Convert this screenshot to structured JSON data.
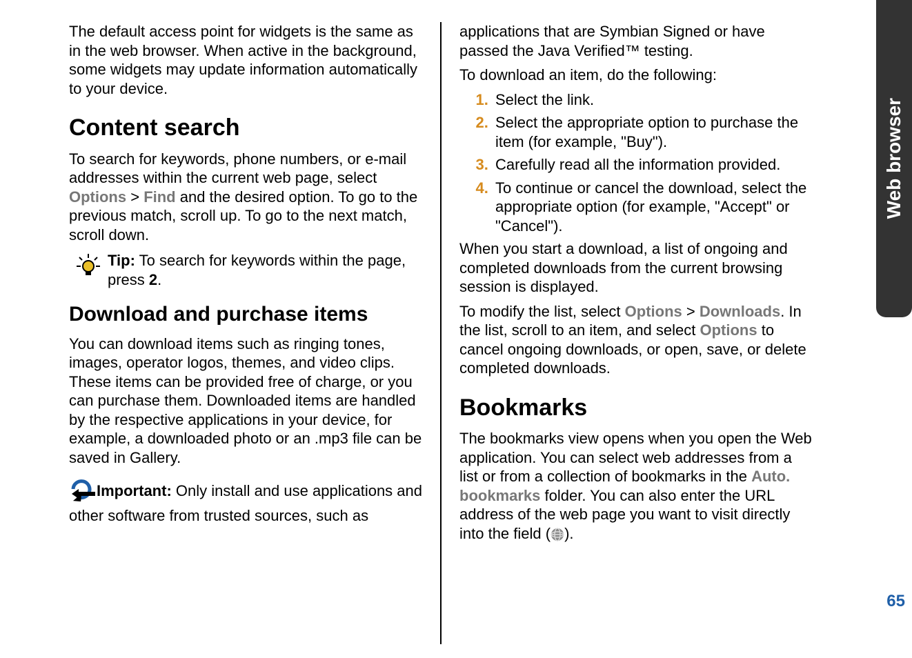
{
  "sidebar": {
    "label": "Web browser"
  },
  "page_number": "65",
  "left": {
    "para1": "The default access point for widgets is the same as in the web browser. When active in the background, some widgets may update information automatically to your device.",
    "h_search": "Content search",
    "search_pre": "To search for keywords, phone numbers, or e-mail addresses within the current web page, select ",
    "options": "Options",
    "gt": " > ",
    "find": "Find",
    "search_post": " and the desired option. To go to the previous match, scroll up. To go to the next match, scroll down.",
    "tip_label": "Tip:",
    "tip_text": " To search for keywords within the page, press ",
    "tip_key": "2",
    "tip_end": ".",
    "h_download": "Download and purchase items",
    "download_para": "You can download items such as ringing tones, images, operator logos, themes, and video clips. These items can be provided free of charge, or you can purchase them. Downloaded items are handled by the respective applications in your device, for example, a downloaded photo or an .mp3 file can be saved in Gallery.",
    "important_label": "Important:",
    "important_text": "  Only install and use applications and other software from trusted sources, such as "
  },
  "right": {
    "cont": "applications that are Symbian Signed or have passed the Java Verified™ testing.",
    "dl_intro": "To download an item, do the following:",
    "steps": [
      "Select the link.",
      "Select the appropriate option to purchase the item (for example, \"Buy\").",
      "Carefully read all the information provided.",
      "To continue or cancel the download, select the appropriate option (for example, \"Accept\" or \"Cancel\")."
    ],
    "dl_note": "When you start a download, a list of ongoing and completed downloads from the current browsing session is displayed.",
    "modify_pre": "To modify the list, select ",
    "options": "Options",
    "gt": " > ",
    "downloads": "Downloads",
    "modify_mid": ". In the list, scroll to an item, and select ",
    "options2": "Options",
    "modify_post": " to cancel ongoing downloads, or open, save, or delete completed downloads.",
    "h_bookmarks": "Bookmarks",
    "bm_pre": "The bookmarks view opens when you open the Web application. You can select web addresses from a list or from a collection of bookmarks in the ",
    "auto_bookmarks": "Auto. bookmarks",
    "bm_mid": " folder. You can also enter the URL address of the web page you want to visit directly into the field (",
    "bm_post": ")."
  }
}
